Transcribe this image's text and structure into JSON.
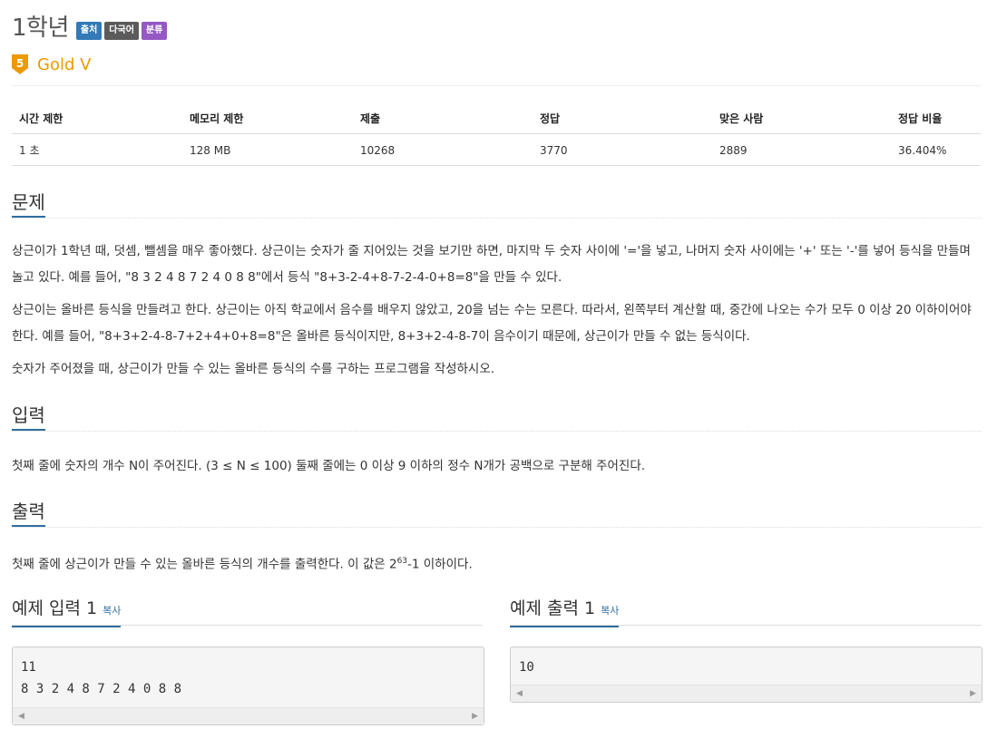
{
  "problem": {
    "title": "1학년",
    "badges": [
      {
        "label": "출처",
        "color": "#337ab7"
      },
      {
        "label": "다국어",
        "color": "#5b5b5b"
      },
      {
        "label": "분류",
        "color": "#9558c4"
      }
    ],
    "tier": {
      "number": "5",
      "label": "Gold V",
      "color": "#ec9a00"
    }
  },
  "info_table": {
    "headers": [
      "시간 제한",
      "메모리 제한",
      "제출",
      "정답",
      "맞은 사람",
      "정답 비율"
    ],
    "values": [
      "1 초",
      "128 MB",
      "10268",
      "3770",
      "2889",
      "36.404%"
    ]
  },
  "sections": {
    "problem": {
      "title": "문제",
      "p1": "상근이가 1학년 때, 덧셈, 뺄셈을 매우 좋아했다. 상근이는 숫자가 줄 지어있는 것을 보기만 하면, 마지막 두 숫자 사이에 '='을 넣고, 나머지 숫자 사이에는 '+' 또는 '-'를 넣어 등식을 만들며 놀고 있다. 예를 들어, \"8 3 2 4 8 7 2 4 0 8 8\"에서 등식 \"8+3-2-4+8-7-2-4-0+8=8\"을 만들 수 있다.",
      "p2": "상근이는 올바른 등식을 만들려고 한다. 상근이는 아직 학교에서 음수를 배우지 않았고, 20을 넘는 수는 모른다. 따라서, 왼쪽부터 계산할 때, 중간에 나오는 수가 모두 0 이상 20 이하이어야 한다. 예를 들어, \"8+3+2-4-8-7+2+4+0+8=8\"은 올바른 등식이지만, 8+3+2-4-8-7이 음수이기 때문에, 상근이가 만들 수 없는 등식이다.",
      "p3": "숫자가 주어졌을 때, 상근이가 만들 수 있는 올바른 등식의 수를 구하는 프로그램을 작성하시오."
    },
    "input": {
      "title": "입력",
      "p1": "첫째 줄에 숫자의 개수 N이 주어진다. (3 ≤ N ≤ 100) 둘째 줄에는 0 이상 9 이하의 정수 N개가 공백으로 구분해 주어진다."
    },
    "output": {
      "title": "출력",
      "p1_before": "첫째 줄에 상근이가 만들 수 있는 올바른 등식의 개수를 출력한다. 이 값은 2",
      "p1_sup": "63",
      "p1_after": "-1 이하이다."
    }
  },
  "samples": {
    "copy_label": "복사",
    "input_title": "예제 입력 1",
    "input_text": "11\n8 3 2 4 8 7 2 4 0 8 8",
    "output_title": "예제 출력 1",
    "output_text": "10"
  }
}
